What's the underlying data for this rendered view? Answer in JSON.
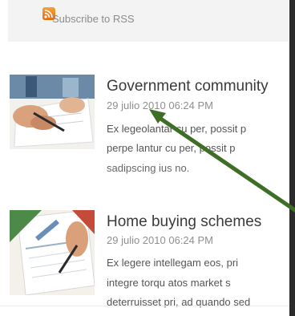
{
  "subscribe": {
    "label": "Subscribe to RSS",
    "icon": "rss-icon"
  },
  "posts": [
    {
      "title": "Government community",
      "date": "29 julio 2010 06:24 PM",
      "excerpt_lines": [
        "Ex legeolantar cu per, possit p",
        "perpe lantur cu per, possit p",
        "sadipscing ius no."
      ]
    },
    {
      "title": "Home buying schemes",
      "date": "29 julio 2010 06:24 PM",
      "excerpt_lines": [
        "Ex legere intellegam eos, pri",
        "integre torqu atos market s",
        "deterruisset pri, ad quando sed"
      ]
    }
  ],
  "annotation": {
    "arrow_color": "#3f6f26"
  }
}
